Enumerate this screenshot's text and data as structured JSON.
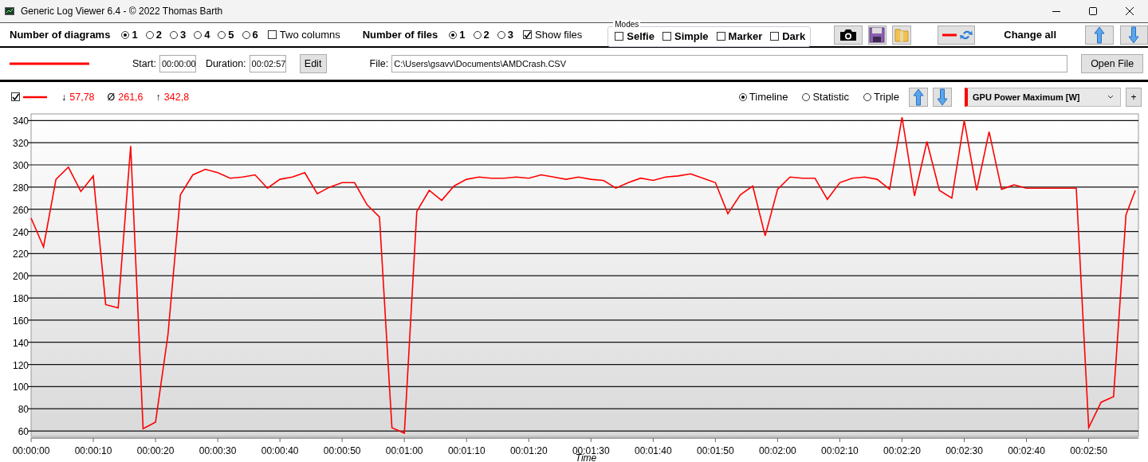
{
  "window": {
    "title": "Generic Log Viewer 6.4 - © 2022 Thomas Barth"
  },
  "toolbar": {
    "diagrams": {
      "label": "Number of diagrams",
      "options": [
        {
          "label": "1",
          "selected": true
        },
        {
          "label": "2",
          "selected": false
        },
        {
          "label": "3",
          "selected": false
        },
        {
          "label": "4",
          "selected": false
        },
        {
          "label": "5",
          "selected": false
        },
        {
          "label": "6",
          "selected": false
        }
      ],
      "two_columns": {
        "label": "Two columns",
        "checked": false
      }
    },
    "files": {
      "label": "Number of files",
      "options": [
        {
          "label": "1",
          "selected": true
        },
        {
          "label": "2",
          "selected": false
        },
        {
          "label": "3",
          "selected": false
        }
      ],
      "show_files": {
        "label": "Show files",
        "checked": true
      }
    },
    "modes": {
      "legend": "Modes",
      "items": [
        {
          "label": "Selfie",
          "checked": false
        },
        {
          "label": "Simple",
          "checked": false
        },
        {
          "label": "Marker",
          "checked": false
        },
        {
          "label": "Dark",
          "checked": false
        }
      ]
    },
    "change_all": "Change all"
  },
  "file_row": {
    "start": {
      "label": "Start:",
      "value": "00:00:00"
    },
    "duration": {
      "label": "Duration:",
      "value": "00:02:57"
    },
    "edit_button": "Edit",
    "file": {
      "label": "File:",
      "value": "C:\\Users\\gsavv\\Documents\\AMDCrash.CSV"
    },
    "open_button": "Open File"
  },
  "diagram": {
    "visible": true,
    "stats": [
      {
        "symbol": "↓",
        "value": "57,78"
      },
      {
        "symbol": "Ø",
        "value": "261,6"
      },
      {
        "symbol": "↑",
        "value": "342,8"
      }
    ],
    "views": [
      {
        "label": "Timeline",
        "selected": true
      },
      {
        "label": "Statistic",
        "selected": false
      },
      {
        "label": "Triple",
        "selected": false
      }
    ],
    "add_button": "+",
    "chart_data": {
      "type": "line",
      "grid": true,
      "xlabel": "Time",
      "xlim": [
        0,
        178
      ],
      "ylim": [
        55,
        346
      ],
      "yticks": [
        60,
        80,
        100,
        120,
        140,
        160,
        180,
        200,
        220,
        240,
        260,
        280,
        300,
        320,
        340
      ],
      "xticks": [
        {
          "value": 0,
          "label": "00:00:00"
        },
        {
          "value": 10,
          "label": "00:00:10"
        },
        {
          "value": 20,
          "label": "00:00:20"
        },
        {
          "value": 30,
          "label": "00:00:30"
        },
        {
          "value": 40,
          "label": "00:00:40"
        },
        {
          "value": 50,
          "label": "00:00:50"
        },
        {
          "value": 60,
          "label": "00:01:00"
        },
        {
          "value": 70,
          "label": "00:01:10"
        },
        {
          "value": 80,
          "label": "00:01:20"
        },
        {
          "value": 90,
          "label": "00:01:30"
        },
        {
          "value": 100,
          "label": "00:01:40"
        },
        {
          "value": 110,
          "label": "00:01:50"
        },
        {
          "value": 120,
          "label": "00:02:00"
        },
        {
          "value": 130,
          "label": "00:02:10"
        },
        {
          "value": 140,
          "label": "00:02:20"
        },
        {
          "value": 150,
          "label": "00:02:30"
        },
        {
          "value": 160,
          "label": "00:02:40"
        },
        {
          "value": 170,
          "label": "00:02:50"
        }
      ],
      "x": [
        0,
        2,
        4,
        6,
        8,
        10,
        12,
        14,
        16,
        18,
        20,
        22,
        24,
        26,
        28,
        30,
        32,
        34,
        36,
        38,
        40,
        42,
        44,
        46,
        48,
        50,
        52,
        54,
        56,
        58,
        60,
        62,
        64,
        66,
        68,
        70,
        72,
        74,
        76,
        78,
        80,
        82,
        84,
        86,
        88,
        90,
        92,
        94,
        96,
        98,
        100,
        102,
        104,
        106,
        108,
        110,
        112,
        114,
        116,
        118,
        120,
        122,
        124,
        126,
        128,
        130,
        132,
        134,
        136,
        138,
        140,
        142,
        144,
        146,
        148,
        150,
        152,
        154,
        156,
        158,
        160,
        162,
        164,
        166,
        168,
        170,
        172,
        174,
        176,
        177.5
      ],
      "series": [
        {
          "name": "GPU Power Maximum [W]",
          "color": "#ff0000",
          "values": [
            252,
            226,
            287,
            298,
            276,
            290,
            174,
            171,
            317,
            62,
            68,
            147,
            273,
            291,
            296,
            293,
            288,
            289,
            291,
            279,
            287,
            289,
            293,
            274,
            280,
            284,
            284,
            264,
            253,
            63,
            58,
            258,
            277,
            268,
            281,
            287,
            289,
            288,
            288,
            289,
            288,
            291,
            289,
            287,
            289,
            287,
            286,
            279,
            284,
            288,
            286,
            289,
            290,
            292,
            288,
            284,
            256,
            273,
            281,
            236,
            278,
            289,
            288,
            288,
            269,
            284,
            288,
            289,
            287,
            278,
            343,
            272,
            321,
            277,
            270,
            340,
            277,
            330,
            278,
            282,
            279,
            279,
            279,
            279,
            279,
            63,
            86,
            91,
            255,
            277
          ]
        }
      ]
    }
  }
}
